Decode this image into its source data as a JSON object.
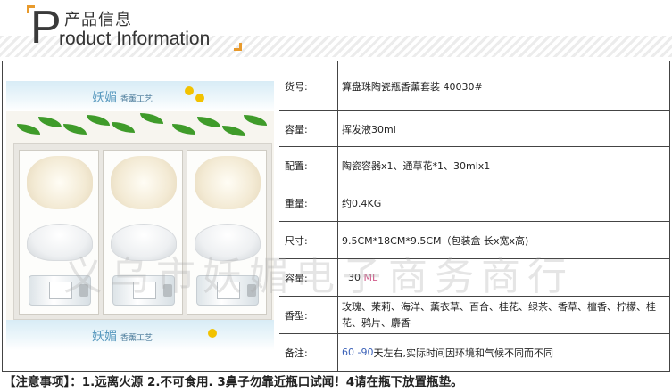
{
  "header": {
    "cn_title": "产品信息",
    "initial": "P",
    "en_title": "roduct Information"
  },
  "photo": {
    "banner_text": "妖媚",
    "banner_sub": "香薰工艺"
  },
  "rows": [
    {
      "label": "货号:",
      "value": "算盘珠陶瓷瓶香薰套装     40030#"
    },
    {
      "label": "容量:",
      "value": "挥发液30ml"
    },
    {
      "label": "配置:",
      "value": "陶瓷容器x1、通草花*1、30mlx1"
    },
    {
      "label": "重量:",
      "value": "约0.4KG"
    },
    {
      "label": "尺寸:",
      "value": "  9.5CM*18CM*9.5CM（包装盒 长x宽x高)"
    },
    {
      "label": "容量:",
      "value_num": "  30 ",
      "value_unit": "ML"
    },
    {
      "label": "香型:",
      "value": "玫瑰、茉莉、海洋、薰衣草、百合、桂花、绿茶、香草、檀香、柠檬、桂花、鸦片、麝香"
    },
    {
      "label": "备注:",
      "value_days": "60 -90",
      "value_rest": "天左右,实际时间因环境和气候不同而不同"
    }
  ],
  "watermark": "义乌市妖媚电子商务商行",
  "notice": "【注意事项】：1.远离火源  2.不可食用. 3鼻子勿靠近瓶口试闻！4请在瓶下放置瓶垫。"
}
